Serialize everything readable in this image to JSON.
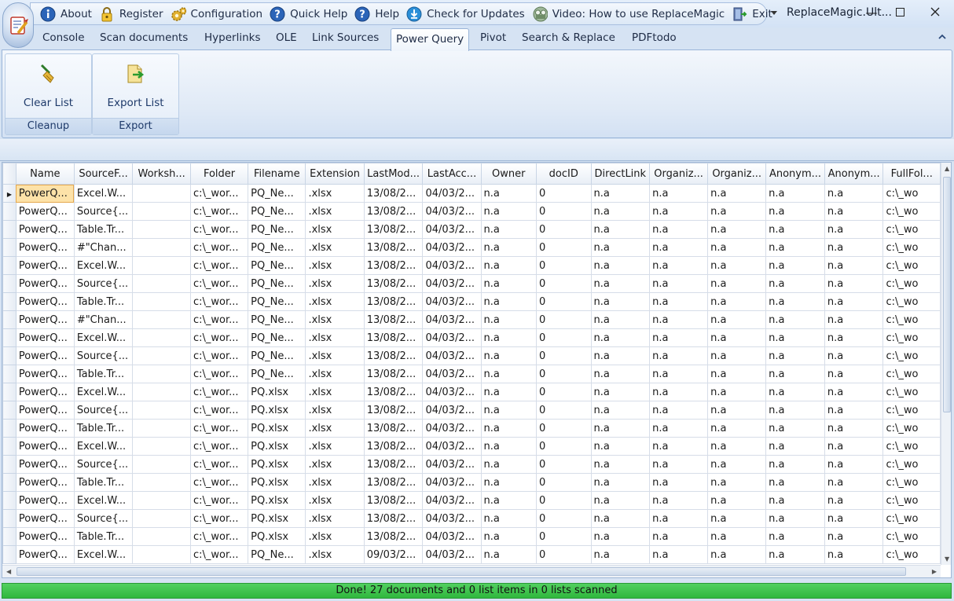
{
  "quick_access": [
    {
      "label": "About",
      "icon": "info-icon"
    },
    {
      "label": "Register",
      "icon": "lock-icon"
    },
    {
      "label": "Configuration",
      "icon": "gears-icon"
    },
    {
      "label": "Quick Help",
      "icon": "help-icon"
    },
    {
      "label": "Help",
      "icon": "help-icon"
    },
    {
      "label": "Check for Updates",
      "icon": "download-icon"
    },
    {
      "label": "Video: How to use ReplaceMagic",
      "icon": "video-icon"
    },
    {
      "label": "Exit",
      "icon": "exit-door-icon"
    }
  ],
  "window": {
    "title": "ReplaceMagic.Ult..."
  },
  "tabs": [
    "Console",
    "Scan documents",
    "Hyperlinks",
    "OLE",
    "Link Sources",
    "Power Query",
    "Pivot",
    "Search & Replace",
    "PDFtodo"
  ],
  "active_tab": "Power Query",
  "ribbon": {
    "groups": [
      {
        "caption": "Cleanup",
        "button": "Clear List",
        "icon": "broom-icon"
      },
      {
        "caption": "Export",
        "button": "Export List",
        "icon": "export-icon"
      }
    ]
  },
  "grid": {
    "columns": [
      "Name",
      "SourceF...",
      "Worksh...",
      "Folder",
      "Filename",
      "Extension",
      "LastMod...",
      "LastAcc...",
      "Owner",
      "docID",
      "DirectLink",
      "Organiz...",
      "Organiz...",
      "Anonym...",
      "Anonym...",
      "FullFol..."
    ],
    "rows": [
      [
        "PowerQ...",
        "Excel.W...",
        "",
        "c:\\_wor...",
        "PQ_Ne...",
        ".xlsx",
        "13/08/2...",
        "04/03/2...",
        "n.a",
        "0",
        "n.a",
        "n.a",
        "n.a",
        "n.a",
        "n.a",
        "c:\\_wo"
      ],
      [
        "PowerQ...",
        "Source{...",
        "",
        "c:\\_wor...",
        "PQ_Ne...",
        ".xlsx",
        "13/08/2...",
        "04/03/2...",
        "n.a",
        "0",
        "n.a",
        "n.a",
        "n.a",
        "n.a",
        "n.a",
        "c:\\_wo"
      ],
      [
        "PowerQ...",
        "Table.Tr...",
        "",
        "c:\\_wor...",
        "PQ_Ne...",
        ".xlsx",
        "13/08/2...",
        "04/03/2...",
        "n.a",
        "0",
        "n.a",
        "n.a",
        "n.a",
        "n.a",
        "n.a",
        "c:\\_wo"
      ],
      [
        "PowerQ...",
        "#\"Chan...",
        "",
        "c:\\_wor...",
        "PQ_Ne...",
        ".xlsx",
        "13/08/2...",
        "04/03/2...",
        "n.a",
        "0",
        "n.a",
        "n.a",
        "n.a",
        "n.a",
        "n.a",
        "c:\\_wo"
      ],
      [
        "PowerQ...",
        "Excel.W...",
        "",
        "c:\\_wor...",
        "PQ_Ne...",
        ".xlsx",
        "13/08/2...",
        "04/03/2...",
        "n.a",
        "0",
        "n.a",
        "n.a",
        "n.a",
        "n.a",
        "n.a",
        "c:\\_wo"
      ],
      [
        "PowerQ...",
        "Source{...",
        "",
        "c:\\_wor...",
        "PQ_Ne...",
        ".xlsx",
        "13/08/2...",
        "04/03/2...",
        "n.a",
        "0",
        "n.a",
        "n.a",
        "n.a",
        "n.a",
        "n.a",
        "c:\\_wo"
      ],
      [
        "PowerQ...",
        "Table.Tr...",
        "",
        "c:\\_wor...",
        "PQ_Ne...",
        ".xlsx",
        "13/08/2...",
        "04/03/2...",
        "n.a",
        "0",
        "n.a",
        "n.a",
        "n.a",
        "n.a",
        "n.a",
        "c:\\_wo"
      ],
      [
        "PowerQ...",
        "#\"Chan...",
        "",
        "c:\\_wor...",
        "PQ_Ne...",
        ".xlsx",
        "13/08/2...",
        "04/03/2...",
        "n.a",
        "0",
        "n.a",
        "n.a",
        "n.a",
        "n.a",
        "n.a",
        "c:\\_wo"
      ],
      [
        "PowerQ...",
        "Excel.W...",
        "",
        "c:\\_wor...",
        "PQ_Ne...",
        ".xlsx",
        "13/08/2...",
        "04/03/2...",
        "n.a",
        "0",
        "n.a",
        "n.a",
        "n.a",
        "n.a",
        "n.a",
        "c:\\_wo"
      ],
      [
        "PowerQ...",
        "Source{...",
        "",
        "c:\\_wor...",
        "PQ_Ne...",
        ".xlsx",
        "13/08/2...",
        "04/03/2...",
        "n.a",
        "0",
        "n.a",
        "n.a",
        "n.a",
        "n.a",
        "n.a",
        "c:\\_wo"
      ],
      [
        "PowerQ...",
        "Table.Tr...",
        "",
        "c:\\_wor...",
        "PQ_Ne...",
        ".xlsx",
        "13/08/2...",
        "04/03/2...",
        "n.a",
        "0",
        "n.a",
        "n.a",
        "n.a",
        "n.a",
        "n.a",
        "c:\\_wo"
      ],
      [
        "PowerQ...",
        "Excel.W...",
        "",
        "c:\\_wor...",
        "PQ.xlsx",
        ".xlsx",
        "13/08/2...",
        "04/03/2...",
        "n.a",
        "0",
        "n.a",
        "n.a",
        "n.a",
        "n.a",
        "n.a",
        "c:\\_wo"
      ],
      [
        "PowerQ...",
        "Source{...",
        "",
        "c:\\_wor...",
        "PQ.xlsx",
        ".xlsx",
        "13/08/2...",
        "04/03/2...",
        "n.a",
        "0",
        "n.a",
        "n.a",
        "n.a",
        "n.a",
        "n.a",
        "c:\\_wo"
      ],
      [
        "PowerQ...",
        "Table.Tr...",
        "",
        "c:\\_wor...",
        "PQ.xlsx",
        ".xlsx",
        "13/08/2...",
        "04/03/2...",
        "n.a",
        "0",
        "n.a",
        "n.a",
        "n.a",
        "n.a",
        "n.a",
        "c:\\_wo"
      ],
      [
        "PowerQ...",
        "Excel.W...",
        "",
        "c:\\_wor...",
        "PQ.xlsx",
        ".xlsx",
        "13/08/2...",
        "04/03/2...",
        "n.a",
        "0",
        "n.a",
        "n.a",
        "n.a",
        "n.a",
        "n.a",
        "c:\\_wo"
      ],
      [
        "PowerQ...",
        "Source{...",
        "",
        "c:\\_wor...",
        "PQ.xlsx",
        ".xlsx",
        "13/08/2...",
        "04/03/2...",
        "n.a",
        "0",
        "n.a",
        "n.a",
        "n.a",
        "n.a",
        "n.a",
        "c:\\_wo"
      ],
      [
        "PowerQ...",
        "Table.Tr...",
        "",
        "c:\\_wor...",
        "PQ.xlsx",
        ".xlsx",
        "13/08/2...",
        "04/03/2...",
        "n.a",
        "0",
        "n.a",
        "n.a",
        "n.a",
        "n.a",
        "n.a",
        "c:\\_wo"
      ],
      [
        "PowerQ...",
        "Excel.W...",
        "",
        "c:\\_wor...",
        "PQ.xlsx",
        ".xlsx",
        "13/08/2...",
        "04/03/2...",
        "n.a",
        "0",
        "n.a",
        "n.a",
        "n.a",
        "n.a",
        "n.a",
        "c:\\_wo"
      ],
      [
        "PowerQ...",
        "Source{...",
        "",
        "c:\\_wor...",
        "PQ.xlsx",
        ".xlsx",
        "13/08/2...",
        "04/03/2...",
        "n.a",
        "0",
        "n.a",
        "n.a",
        "n.a",
        "n.a",
        "n.a",
        "c:\\_wo"
      ],
      [
        "PowerQ...",
        "Table.Tr...",
        "",
        "c:\\_wor...",
        "PQ.xlsx",
        ".xlsx",
        "13/08/2...",
        "04/03/2...",
        "n.a",
        "0",
        "n.a",
        "n.a",
        "n.a",
        "n.a",
        "n.a",
        "c:\\_wo"
      ],
      [
        "PowerQ...",
        "Excel.W...",
        "",
        "c:\\_wor...",
        "PQ_Ne...",
        ".xlsx",
        "09/03/2...",
        "04/03/2...",
        "n.a",
        "0",
        "n.a",
        "n.a",
        "n.a",
        "n.a",
        "n.a",
        "c:\\_wo"
      ]
    ]
  },
  "status": {
    "text": "Done! 27 documents and 0 list items in 0 lists scanned",
    "color": "#3cc24a"
  }
}
